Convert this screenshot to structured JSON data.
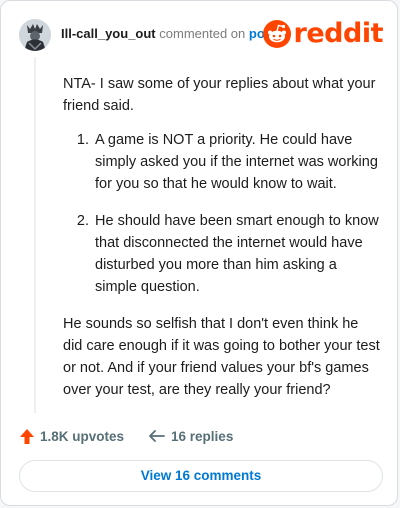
{
  "header": {
    "username": "Ill-call_you_out",
    "commented_text": "commented on",
    "post_link": "post",
    "logo_word": "reddit"
  },
  "comment": {
    "intro": "NTA- I saw some of your replies about what your friend said.",
    "points": [
      "A game is NOT a priority. He could have simply asked you if the internet was working for you so that he would know to wait.",
      "He should have been smart enough to know that disconnected the internet would have disturbed you more than him asking a simple question."
    ],
    "closing": "He sounds so selfish that I don't even think he did care enough if it was going to bother your test or not. And if your friend values your bf's games over your test, are they really your friend?"
  },
  "actions": {
    "upvotes": "1.8K upvotes",
    "replies": "16 replies"
  },
  "view_button": "View 16 comments",
  "colors": {
    "brand": "#ff4500",
    "link": "#0079d3",
    "muted": "#576f76"
  }
}
